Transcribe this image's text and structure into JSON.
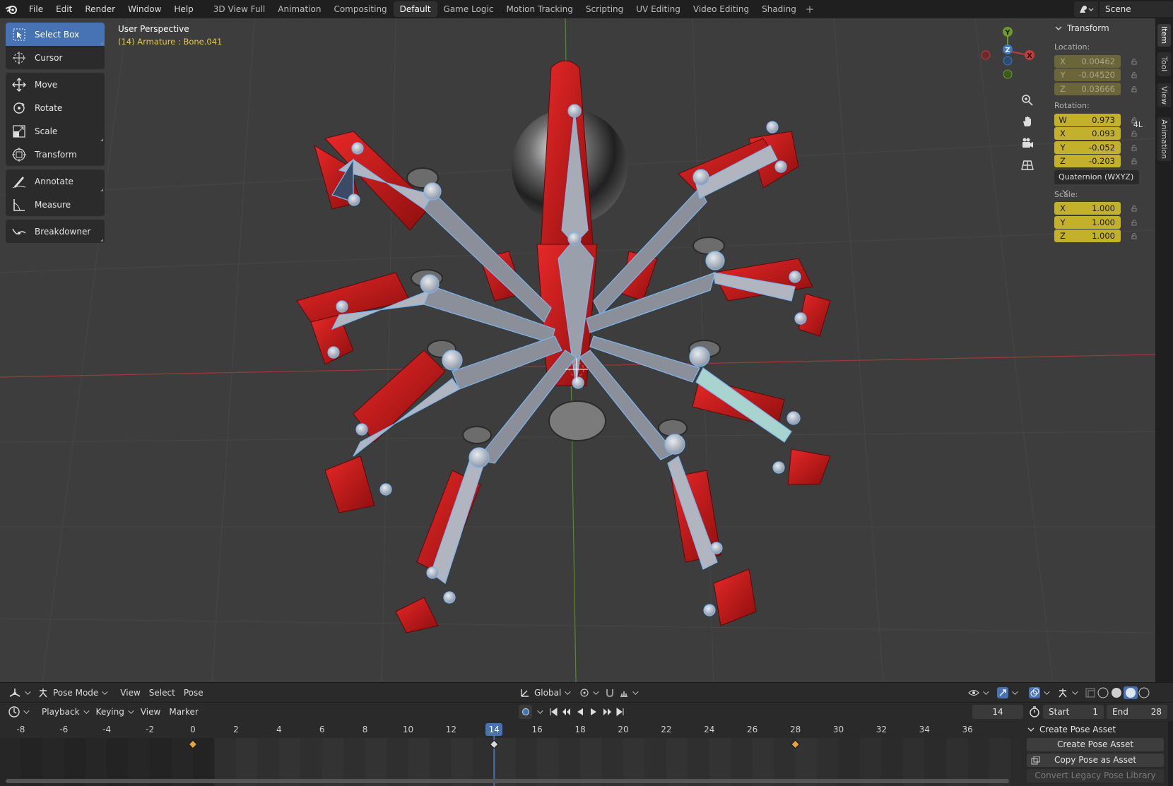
{
  "topbar": {
    "menus": [
      "File",
      "Edit",
      "Render",
      "Window",
      "Help"
    ],
    "workspaces": [
      "3D View Full",
      "Animation",
      "Compositing",
      "Default",
      "Game Logic",
      "Motion Tracking",
      "Scripting",
      "UV Editing",
      "Video Editing",
      "Shading"
    ],
    "active_workspace": "Default",
    "scene_name": "Scene"
  },
  "viewport": {
    "title": "User Perspective",
    "subtitle": "(14) Armature : Bone.041"
  },
  "toolbar": {
    "tools": [
      {
        "label": "Select Box",
        "icon": "select-box-icon"
      },
      {
        "label": "Cursor",
        "icon": "cursor-icon"
      },
      {
        "label": "Move",
        "icon": "move-icon"
      },
      {
        "label": "Rotate",
        "icon": "rotate-icon"
      },
      {
        "label": "Scale",
        "icon": "scale-icon"
      },
      {
        "label": "Transform",
        "icon": "transform-icon"
      },
      {
        "label": "Annotate",
        "icon": "annotate-icon"
      },
      {
        "label": "Measure",
        "icon": "measure-icon"
      },
      {
        "label": "Breakdowner",
        "icon": "breakdowner-icon"
      }
    ],
    "active_tool": "Select Box"
  },
  "gizmo": {
    "x": "X",
    "y": "Y",
    "z": "Z"
  },
  "transform_panel": {
    "title": "Transform",
    "location_label": "Location:",
    "location": [
      {
        "axis": "X",
        "value": "0.00462"
      },
      {
        "axis": "Y",
        "value": "-0.04520"
      },
      {
        "axis": "Z",
        "value": "0.03666"
      }
    ],
    "rotation_label": "Rotation:",
    "rotation_mode_short": "4L",
    "rotation": [
      {
        "axis": "W",
        "value": "0.973"
      },
      {
        "axis": "X",
        "value": "0.093"
      },
      {
        "axis": "Y",
        "value": "-0.052"
      },
      {
        "axis": "Z",
        "value": "-0.203"
      }
    ],
    "rotation_mode": "Quaternion (WXYZ)",
    "scale_label": "Scale:",
    "scale": [
      {
        "axis": "X",
        "value": "1.000"
      },
      {
        "axis": "Y",
        "value": "1.000"
      },
      {
        "axis": "Z",
        "value": "1.000"
      }
    ]
  },
  "side_tabs": [
    "Item",
    "Tool",
    "View",
    "Animation"
  ],
  "viewport_header": {
    "mode": "Pose Mode",
    "menus": [
      "View",
      "Select",
      "Pose"
    ],
    "orientation": "Global"
  },
  "timeline_header": {
    "menus": [
      "Playback",
      "Keying",
      "View",
      "Marker"
    ],
    "current_frame": "14",
    "start_label": "Start",
    "start": "1",
    "end_label": "End",
    "end": "28"
  },
  "timeline": {
    "ticks": [
      "-8",
      "-6",
      "-4",
      "-2",
      "0",
      "2",
      "4",
      "6",
      "8",
      "10",
      "12",
      "14",
      "16",
      "18",
      "20",
      "22",
      "24",
      "26",
      "28",
      "30",
      "32",
      "34",
      "36"
    ],
    "current": "14",
    "keyframes": [
      0,
      14,
      28
    ]
  },
  "pose_panel": {
    "title": "Create Pose Asset",
    "buttons": [
      "Create Pose Asset",
      "Copy Pose as Asset",
      "Convert Legacy Pose Library"
    ]
  },
  "colors": {
    "accent": "#4772b3",
    "rotation_field": "#c3b12b",
    "location_field": "#6b6639",
    "grid_x_axis": "#b23a3a",
    "grid_y_axis": "#4f8f2a",
    "bone": "#8a8f9a",
    "mesh_red": "#c81e1e"
  }
}
